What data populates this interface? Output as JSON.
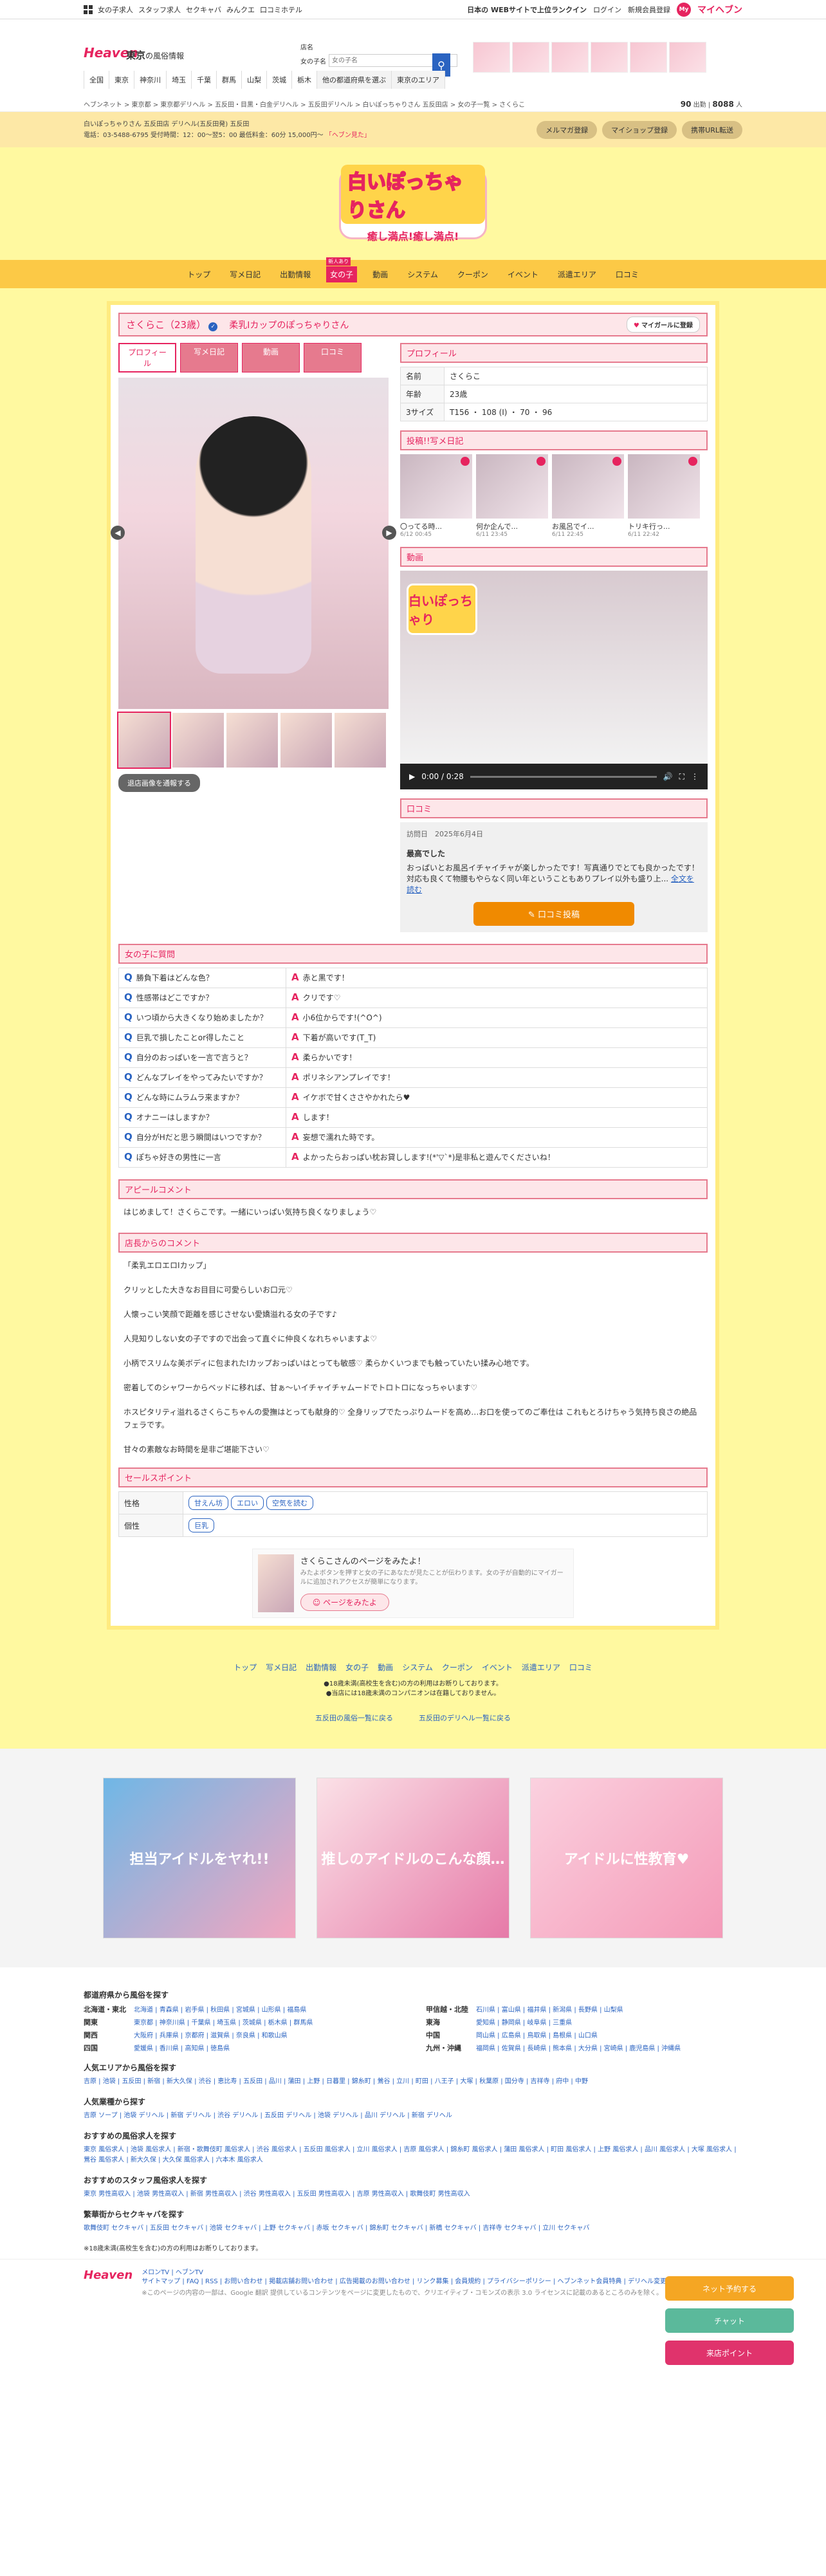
{
  "topbar": {
    "left": [
      "女の子求人",
      "スタッフ求人",
      "セクキャバ",
      "みんクエ",
      "口コミホテル"
    ],
    "right": [
      "日本の WEBサイトで上位ランクイン",
      "ログイン",
      "新規会員登録"
    ],
    "my": "マイヘブン",
    "heart": "My"
  },
  "header": {
    "logo": "Heaven",
    "region": "東京",
    "region_suffix": "の風俗情報",
    "search_label1": "店名",
    "search_label2": "女の子名",
    "search_placeholder": "女の子名",
    "search_icon": "search-icon"
  },
  "areanav": [
    "全国",
    "東京",
    "神奈川",
    "埼玉",
    "千葉",
    "群馬",
    "山梨",
    "茨城",
    "栃木",
    "他の都道府県を選ぶ",
    "東京のエリア"
  ],
  "breadcrumb": "ヘブンネット > 東京都 > 東京都デリヘル > 五反田・目黒・白金デリヘル > 五反田デリヘル > 白いぽっちゃりさん 五反田店 > 女の子一覧 > さくらこ",
  "stats": {
    "n1": "90",
    "l1": "出勤",
    "n2": "8088",
    "l2": "人"
  },
  "shop": {
    "line1": "白いぽっちゃりさん 五反田店 デリヘル(五反田発) 五反田",
    "line2": "電話：03-5488-6795 受付時間：12：00～翌5：00",
    "line2b": "最低料金：60分 15,000円～",
    "pink": "「ヘブン見た」",
    "btns": [
      "メルマガ登録",
      "マイショップ登録",
      "携帯URL転送"
    ]
  },
  "hero": {
    "t1": "白いぽっちゃりさん",
    "t2": "癒し満点!癒し満点!"
  },
  "mainnav": [
    {
      "label": "トップ"
    },
    {
      "label": "写メ日記"
    },
    {
      "label": "出勤情報"
    },
    {
      "label": "女の子",
      "badge": "新人あり",
      "active": true
    },
    {
      "label": "動画"
    },
    {
      "label": "システム"
    },
    {
      "label": "クーポン"
    },
    {
      "label": "イベント"
    },
    {
      "label": "派遣エリア"
    },
    {
      "label": "口コミ"
    }
  ],
  "girl": {
    "name": "さくらこ（23歳）",
    "catch": "柔乳Iカップのぽっちゃりさん",
    "fav": "マイガールに登録",
    "tabs": [
      "プロフィール",
      "写メ日記",
      "動画",
      "口コミ"
    ],
    "wm_btn": "退店画像を通報する"
  },
  "profile": {
    "heading": "プロフィール",
    "rows": [
      {
        "k": "名前",
        "v": "さくらこ"
      },
      {
        "k": "年齢",
        "v": "23歳"
      },
      {
        "k": "3サイズ",
        "v": "T156 ・ 108 (I) ・ 70 ・ 96"
      }
    ]
  },
  "diary": {
    "heading": "投稿!!写メ日記",
    "items": [
      {
        "t": "〇ってる時...",
        "d": "6/12 00:45"
      },
      {
        "t": "何か企んで...",
        "d": "6/11 23:45"
      },
      {
        "t": "お風呂でイ...",
        "d": "6/11 22:45"
      },
      {
        "t": "トリキ行っ...",
        "d": "6/11 22:42"
      }
    ]
  },
  "video": {
    "heading": "動画",
    "time": "0:00 / 0:28",
    "badge": "白いぽっちゃり"
  },
  "review": {
    "heading": "口コミ",
    "date_label": "訪問日",
    "date": "2025年6月4日",
    "title": "最高でした",
    "body": "おっぱいとお風呂イチャイチャが楽しかったです！写真通りでとても良かったです！対応も良くて物腰もやらなく同い年ということもありプレイ以外も盛り上...",
    "more": "全文を読む",
    "post": "口コミ投稿"
  },
  "qa": {
    "heading": "女の子に質問",
    "rows": [
      {
        "q": "勝負下着はどんな色？",
        "a": "赤と黒です！"
      },
      {
        "q": "性感帯はどこですか？",
        "a": "クリです♡"
      },
      {
        "q": "いつ頃から大きくなり始めましたか？",
        "a": "小6位からです!(^O^)"
      },
      {
        "q": "巨乳で損したことor得したこと",
        "a": "下着が高いです(T_T)"
      },
      {
        "q": "自分のおっぱいを一言で言うと？",
        "a": "柔らかいです！"
      },
      {
        "q": "どんなプレイをやってみたいですか？",
        "a": "ポリネシアンプレイです！"
      },
      {
        "q": "どんな時にムラムラ来ますか？",
        "a": "イケボで甘くささやかれたら♥"
      },
      {
        "q": "オナニーはしますか？",
        "a": "します！"
      },
      {
        "q": "自分がHだと思う瞬間はいつですか？",
        "a": "妄想で濡れた時です。"
      },
      {
        "q": "ぽちゃ好きの男性に一言",
        "a": "よかったらおっぱい枕お貸しします!(*'▽`*)是非私と遊んでくださいね！"
      }
    ]
  },
  "appeal": {
    "heading": "アピールコメント",
    "text": "はじめまして！さくらこです。一緒にいっぱい気持ち良くなりましょう♡"
  },
  "shopcomment": {
    "heading": "店長からのコメント",
    "paras": [
      "「柔乳エロエロIカップ」",
      "クリッとした大きなお目目に可愛らしいお口元♡",
      "人懐っこい笑顔で距離を感じさせない愛嬌溢れる女の子です♪",
      "人見知りしない女の子ですので出会って直ぐに仲良くなれちゃいますよ♡",
      "小柄でスリムな美ボディに包まれたIカップおっぱいはとっても敏感♡ 柔らかくいつまでも触っていたい揉み心地です。",
      "密着してのシャワーからベッドに移れば、甘ぁ～いイチャイチャムードでトロトロになっちゃいます♡",
      "ホスピタリティ溢れるさくらこちゃんの愛撫はとっても献身的♡ 全身リップでたっぷりムードを高め…お口を使ってのご奉仕は これもとろけちゃう気持ち良さの絶品フェラです。",
      "甘々の素敵なお時間を是非ご堪能下さい♡"
    ]
  },
  "points": {
    "heading": "セールスポイント",
    "rows": [
      {
        "k": "性格",
        "tags": [
          "甘えん坊",
          "エロい",
          "空気を読む"
        ]
      },
      {
        "k": "個性",
        "tags": [
          "巨乳"
        ]
      }
    ]
  },
  "share": {
    "title": "さくらこさんのページをみたよ！",
    "sub": "みたよボタンを押すと女の子にあなたが見たことが伝わります。女の子が自動的にマイガールに追加されアクセスが簡単になります。",
    "btn": "ページをみたよ"
  },
  "footnav": {
    "links": [
      "トップ",
      "写メ日記",
      "出勤情報",
      "女の子",
      "動画",
      "システム",
      "クーポン",
      "イベント",
      "派遣エリア",
      "口コミ"
    ],
    "note1": "●18歳未満(高校生を含む)の方の利用はお断りしております。",
    "note2": "●当店には18歳未満のコンパニオンは在籍しておりません。",
    "sub": [
      "五反田の風俗一覧に戻る",
      "五反田のデリヘル一覧に戻る"
    ]
  },
  "ads": [
    "担当アイドルをヤれ!!",
    "推しのアイドルのこんな顔…",
    "アイドルに性教育♥"
  ],
  "directory": {
    "h1": "都道府県から風俗を探す",
    "regions": [
      {
        "r": "北海道・東北",
        "p": "北海道 | 青森県 | 岩手県 | 秋田県 | 宮城県 | 山形県 | 福島県"
      },
      {
        "r": "甲信越・北陸",
        "p": "石川県 | 富山県 | 福井県 | 新潟県 | 長野県 | 山梨県"
      },
      {
        "r": "関東",
        "p": "東京都 | 神奈川県 | 千葉県 | 埼玉県 | 茨城県 | 栃木県 | 群馬県"
      },
      {
        "r": "東海",
        "p": "愛知県 | 静岡県 | 岐阜県 | 三重県"
      },
      {
        "r": "関西",
        "p": "大阪府 | 兵庫県 | 京都府 | 滋賀県 | 奈良県 | 和歌山県"
      },
      {
        "r": "中国",
        "p": "岡山県 | 広島県 | 鳥取県 | 島根県 | 山口県"
      },
      {
        "r": "四国",
        "p": "愛媛県 | 香川県 | 高知県 | 徳島県"
      },
      {
        "r": "九州・沖縄",
        "p": "福岡県 | 佐賀県 | 長崎県 | 熊本県 | 大分県 | 宮崎県 | 鹿児島県 | 沖縄県"
      }
    ],
    "h2": "人気エリアから風俗を探す",
    "l2": "吉原 | 池袋 | 五反田 | 新宿 | 新大久保 | 渋谷 | 恵比寿 | 五反田 | 品川 | 蒲田 | 上野 | 日暮里 | 錦糸町 | 鶯谷 | 立川 | 町田 | 八王子 | 大塚 | 秋葉原 | 国分寺 | 吉祥寺 | 府中 | 中野",
    "h3": "人気業種から探す",
    "l3": "吉原 ソープ | 池袋 デリヘル | 新宿 デリヘル | 渋谷 デリヘル | 五反田 デリヘル | 池袋 デリヘル | 品川 デリヘル | 新宿 デリヘル",
    "h4": "おすすめの風俗求人を探す",
    "l4": "東京 風俗求人 | 池袋 風俗求人 | 新宿・歌舞伎町 風俗求人 | 渋谷 風俗求人 | 五反田 風俗求人 | 立川 風俗求人 | 吉原 風俗求人 | 錦糸町 風俗求人 | 蒲田 風俗求人 | 町田 風俗求人 | 上野 風俗求人 | 品川 風俗求人 | 大塚 風俗求人 | 鶯谷 風俗求人 | 新大久保 | 大久保 風俗求人 | 六本木 風俗求人",
    "h5": "おすすめのスタッフ風俗求人を探す",
    "l5": "東京 男性高収入 | 池袋 男性高収入 | 新宿 男性高収入 | 渋谷 男性高収入 | 五反田 男性高収入 | 吉原 男性高収入 | 歌舞伎町 男性高収入",
    "h6": "繁華街からセクキャバを探す",
    "l6": "歌舞伎町 セクキャバ | 五反田 セクキャバ | 池袋 セクキャバ | 上野 セクキャバ | 赤坂 セクキャバ | 錦糸町 セクキャバ | 新橋 セクキャバ | 吉祥寺 セクキャバ | 立川 セクキャバ",
    "note": "※18歳未満(高校生を含む)の方の利用はお断りしております。"
  },
  "floaters": [
    "ネット予約する",
    "チャット",
    "来店ポイント"
  ],
  "footer": {
    "logo": "Heaven",
    "links1": "メロンTV | ヘブンTV",
    "links2": "サイトマップ | FAQ | RSS | お問い合わせ | 掲載店舗お問い合わせ | 広告掲載のお問い合わせ | リンク募集 | 会員規約 | プライバシーポリシー | ヘブンネット会員特典 | デリヘル変更",
    "copy": "※このページの内容の一部は、Google 翻訳 提供しているコンテンツをページに変更したもので、クリエイティブ・コモンズの表示 3.0 ライセンスに記載のあるところのみを除く。"
  }
}
